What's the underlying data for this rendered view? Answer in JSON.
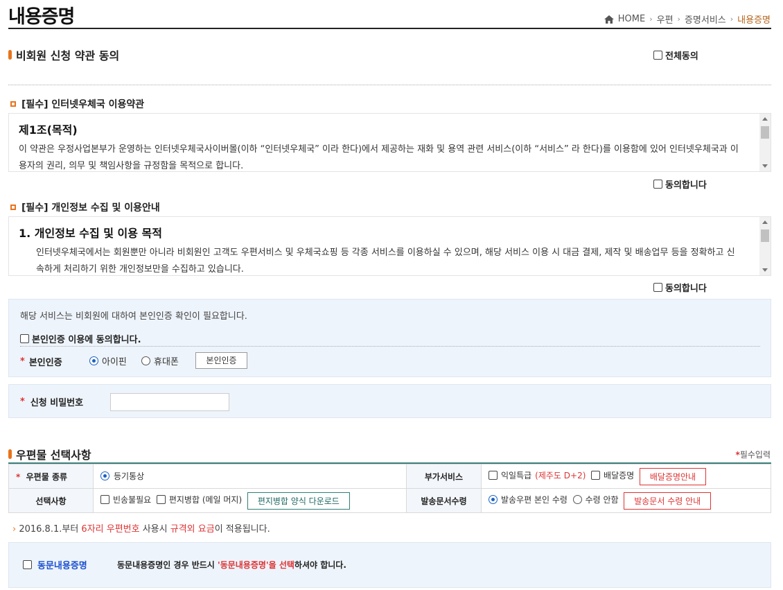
{
  "page": {
    "title": "내용증명",
    "breadcrumb": [
      "HOME",
      "우편",
      "증명서비스",
      "내용증명"
    ]
  },
  "terms_section": {
    "heading": "비회원 신청 약관 동의",
    "agree_all_label": "전체동의"
  },
  "term1": {
    "heading": "[필수] 인터넷우체국 이용약관",
    "article_title": "제1조(목적)",
    "body": "이 약관은 우정사업본부가 운영하는 인터넷우체국사이버몰(이하 “인터넷우체국” 이라 한다)에서 제공하는 재화 및 용역 관련 서비스(이하 “서비스” 라 한다)를 이용함에 있어 인터넷우체국과 이용자의 권리, 의무 및 책임사항을 규정함을 목적으로 합니다.",
    "agree_label": "동의합니다"
  },
  "term2": {
    "heading": "[필수] 개인정보 수집 및 이용안내",
    "article_title": "1. 개인정보 수집 및 이용 목적",
    "body": "인터넷우체국에서는 회원뿐만 아니라 비회원인 고객도 우편서비스 및 우체국쇼핑 등 각종 서비스를 이용하실 수 있으며, 해당 서비스 이용 시 대금 결제, 제작 및 배송업무 등을 정확하고 신속하게 처리하기 위한 개인정보만을 수집하고 있습니다.",
    "agree_label": "동의합니다"
  },
  "identity": {
    "notice": "해당 서비스는 비회원에 대하여 본인인증 확인이 필요합니다.",
    "consent_label": "본인인증 이용에 동의합니다.",
    "field_label": "본인인증",
    "options": [
      "아이핀",
      "휴대폰"
    ],
    "selected": "아이핀",
    "button_label": "본인인증"
  },
  "password": {
    "label": "신청 비밀번호",
    "value": ""
  },
  "mail_options": {
    "heading": "우편물 선택사항",
    "required_note": "필수입력",
    "mail_type_label": "우편물 종류",
    "mail_type_value": "등기통상",
    "extra_service_label": "부가서비스",
    "next_day_label": "익일특급",
    "next_day_note": "(제주도 D+2)",
    "delivery_proof_label": "배달증명",
    "delivery_proof_button": "배달증명안내",
    "options_label": "선택사항",
    "no_return_label": "빈송불필요",
    "merge_label": "편지병합 (메일 머지)",
    "merge_button": "편지병합 양식 다운로드",
    "doc_count_label": "발송문서수령",
    "doc_opt1": "발송우편 본인 수령",
    "doc_opt2": "수령 안함",
    "doc_button": "발송문서 수령 안내"
  },
  "notice": {
    "prefix": "2016.8.1.부터 ",
    "hl1": "6자리 우편번호",
    "mid": " 사용시 ",
    "hl2": "규격외 요금",
    "suffix": "이 적용됩니다."
  },
  "same_content": {
    "label": "동문내용증명",
    "text_prefix": "동문내용증명인 경우 반드시 ",
    "text_highlight": "'동문내용증명'을 선택",
    "text_suffix": "하셔야 합니다."
  },
  "colors": {
    "accent_orange": "#e8731c",
    "breadcrumb_current": "#b5651d",
    "link_blue": "#1a4fd1",
    "alert_red": "#d33333"
  }
}
